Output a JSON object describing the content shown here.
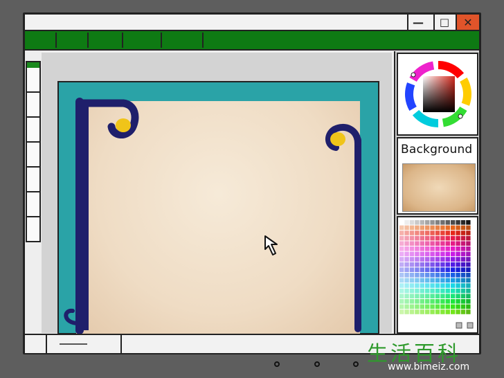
{
  "window": {
    "controls": {
      "minimize_glyph": "—",
      "maximize_glyph": "□",
      "close_glyph": "✕"
    },
    "colors": {
      "title_bar": "#f2f2f2",
      "close": "#e0542a",
      "menu_bar": "#0e7a13"
    }
  },
  "menu_bar": {
    "item_count": 6
  },
  "left_toolbar": {
    "slot_count": 7
  },
  "canvas": {
    "frame_color": "#2aa3a7",
    "ornament_color": "#1f1f6b",
    "accent_color": "#f0c419"
  },
  "right_panel": {
    "color_wheel": {
      "selected_color": "#c0392b"
    },
    "background_layer": {
      "label": "Background"
    },
    "palette": {
      "icon_names": [
        "page-icon",
        "trash-icon"
      ]
    }
  },
  "cursor": {
    "icon": "arrow-cursor-icon"
  },
  "watermark": {
    "chinese": "生活百科",
    "url": "www.bimeiz.com"
  }
}
